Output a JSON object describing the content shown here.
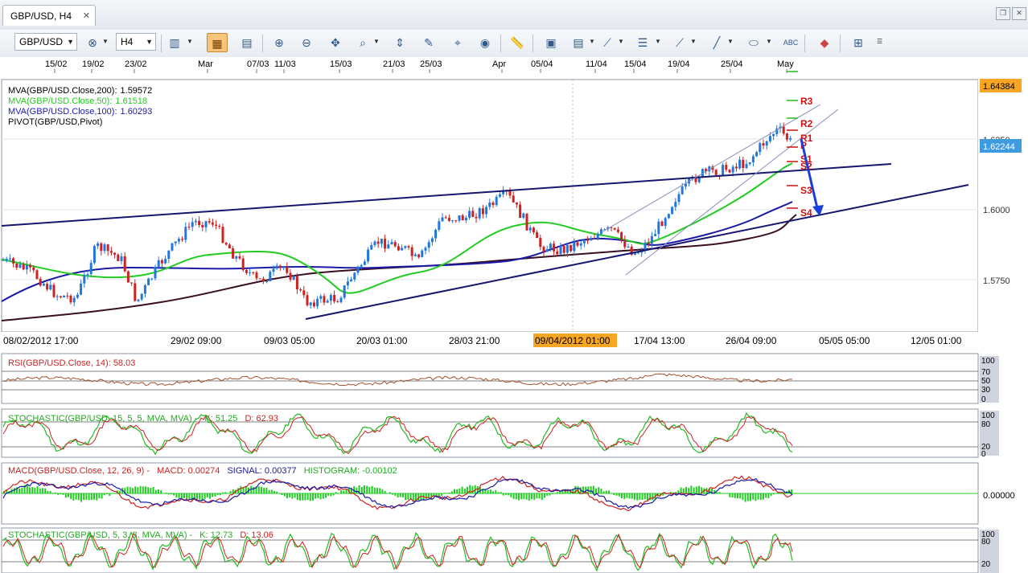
{
  "window": {
    "tab_title": "GBP/USD, H4"
  },
  "toolbar": {
    "symbol": "GBP/USD",
    "timeframe": "H4"
  },
  "top_dates": [
    "15/02",
    "19/02",
    "23/02",
    "Mar",
    "07/03",
    "11/03",
    "15/03",
    "21/03",
    "25/03",
    "Apr",
    "05/04",
    "11/04",
    "15/04",
    "19/04",
    "25/04",
    "May"
  ],
  "bottom_dates": [
    "08/02/2012 17:00",
    "29/02 09:00",
    "09/03 05:00",
    "20/03 01:00",
    "28/03 21:00",
    "09/04/2012 01:00",
    "17/04 13:00",
    "26/04 09:00",
    "05/05 05:00",
    "12/05 01:00"
  ],
  "main_legend": [
    {
      "label": "MVA(GBP/USD.Close,200):",
      "value": "1.59572",
      "color": "#000000"
    },
    {
      "label": "MVA(GBP/USD.Close,50):",
      "value": "1.61518",
      "color": "#22cc22"
    },
    {
      "label": "MVA(GBP/USD.Close,100):",
      "value": "1.60293",
      "color": "#1a1aa8"
    },
    {
      "label": "PIVOT(GBP/USD,Pivot)",
      "value": "",
      "color": "#000000"
    }
  ],
  "price_axis": [
    "1.6250",
    "1.6000",
    "1.5750"
  ],
  "price_tags": {
    "high": "1.64384",
    "current": "1.62244"
  },
  "pivots": [
    "R3",
    "R2",
    "R1",
    "P",
    "S1",
    "S2",
    "S3",
    "S4"
  ],
  "rsi": {
    "legend": "RSI(GBP/USD.Close, 14): 58.03",
    "scale": [
      "100",
      "70",
      "50",
      "30",
      "0"
    ]
  },
  "stoch1": {
    "name": "STOCHASTIC(GBP/USD, 15, 5, 5, MVA, MVA) -",
    "k": "K: 51.25",
    "d": "D: 62.93",
    "scale": [
      "100",
      "80",
      "20",
      "0"
    ]
  },
  "macd": {
    "name": "MACD(GBP/USD.Close, 12, 26, 9) -",
    "macd": "MACD: 0.00274",
    "signal": "SIGNAL: 0.00377",
    "hist": "HISTOGRAM: -0.00102",
    "scale": [
      "0.00000"
    ]
  },
  "stoch2": {
    "name": "STOCHASTIC(GBP/USD, 5, 3, 3, MVA, MVA) -",
    "k": "K: 12.73",
    "d": "D: 13.06",
    "scale": [
      "100",
      "80",
      "20"
    ]
  },
  "icons": [
    "crosshair-icon",
    "bar-chart-icon",
    "candle-chart-icon",
    "line-chart-icon",
    "zoom-in-icon",
    "zoom-out-icon",
    "pan-icon",
    "zoom-window-icon",
    "fit-icon",
    "edit-icon",
    "compass-icon",
    "globe-icon",
    "ruler-icon",
    "picture-icon",
    "save-icon",
    "trendline-icon",
    "channel-icon",
    "fan-icon",
    "pencil-icon",
    "ellipse-icon",
    "text-icon",
    "eraser-icon",
    "tree-icon"
  ]
}
